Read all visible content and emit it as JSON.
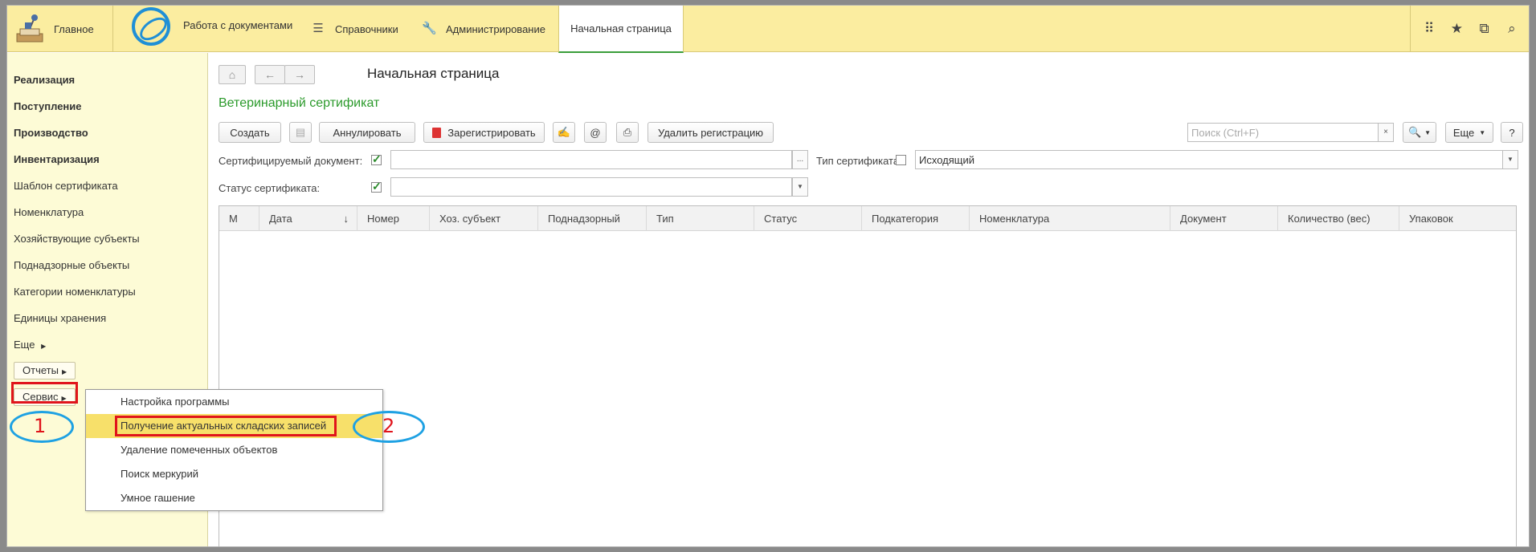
{
  "topbar": {
    "main_label": "Главное",
    "docs_label": "Работа с документами",
    "ref_label": "Справочники",
    "admin_label": "Администрирование",
    "home_label": "Начальная страница",
    "icons": [
      "apps-grid-icon",
      "star-icon",
      "history-icon",
      "search-icon"
    ]
  },
  "sidebar": {
    "items": [
      {
        "label": "Реализация",
        "bold": true
      },
      {
        "label": "Поступление",
        "bold": true
      },
      {
        "label": "Производство",
        "bold": true
      },
      {
        "label": "Инвентаризация",
        "bold": true
      },
      {
        "label": "Шаблон сертификата",
        "bold": false
      },
      {
        "label": "Номенклатура",
        "bold": false
      },
      {
        "label": "Хозяйствующие субъекты",
        "bold": false
      },
      {
        "label": "Поднадзорные объекты",
        "bold": false
      },
      {
        "label": "Категории номенклатуры",
        "bold": false
      },
      {
        "label": "Единицы хранения",
        "bold": false
      },
      {
        "label": "Еще",
        "bold": false
      }
    ],
    "reports_label": "Отчеты",
    "service_label": "Сервис"
  },
  "main": {
    "page_title": "Начальная страница",
    "form_title": "Ветеринарный сертификат",
    "toolbar": {
      "create": "Создать",
      "annul": "Аннулировать",
      "register": "Зарегистрировать",
      "delete_reg": "Удалить регистрацию",
      "search_placeholder": "Поиск (Ctrl+F)",
      "more": "Еще",
      "help": "?"
    },
    "filters": {
      "doc_label": "Сертифицируемый документ:",
      "doc_value": "",
      "type_label": "Тип сертификата:",
      "type_value": "Исходящий",
      "status_label": "Статус сертификата:",
      "status_value": ""
    },
    "table": {
      "columns": [
        "М",
        "Дата",
        "Номер",
        "Хоз. субъект",
        "Поднадзорный",
        "Тип",
        "Статус",
        "Подкатегория",
        "Номенклатура",
        "Документ",
        "Количество (вес)",
        "Упаковок"
      ],
      "rows": []
    }
  },
  "menu": {
    "items": [
      "Настройка программы",
      "Получение актуальных складских записей",
      "Удаление помеченных объектов",
      "Поиск меркурий",
      "Умное гашение"
    ],
    "highlighted_index": 1
  },
  "annotations": {
    "marker1": "1",
    "marker2": "2",
    "color_red": "#e0141b",
    "color_blue": "#1ea1e3"
  }
}
